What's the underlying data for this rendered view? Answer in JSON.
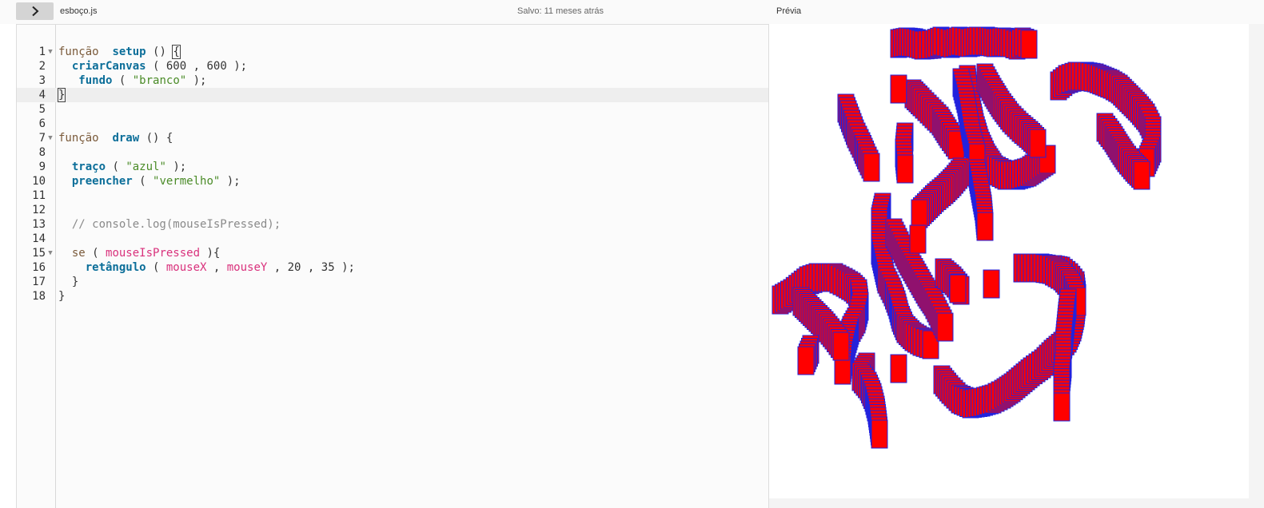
{
  "topbar": {
    "toggle_icon": "chevron-right-icon",
    "file_name": "esboço.js",
    "save_status": "Salvo: 11 meses atrás",
    "preview_label": "Prévia"
  },
  "editor": {
    "lines": [
      {
        "number": "1",
        "fold": "▼",
        "tokens": [
          [
            "kw",
            "função"
          ],
          [
            "p",
            "  "
          ],
          [
            "fn",
            "setup"
          ],
          [
            "p",
            " () "
          ],
          [
            "br",
            "{"
          ]
        ]
      },
      {
        "number": "2",
        "fold": "",
        "tokens": [
          [
            "p",
            "  "
          ],
          [
            "fn",
            "criarCanvas"
          ],
          [
            "p",
            " ( "
          ],
          [
            "num",
            "600"
          ],
          [
            "p",
            " , "
          ],
          [
            "num",
            "600"
          ],
          [
            "p",
            " );"
          ]
        ]
      },
      {
        "number": "3",
        "fold": "",
        "tokens": [
          [
            "p",
            "   "
          ],
          [
            "fn",
            "fundo"
          ],
          [
            "p",
            " ( "
          ],
          [
            "str",
            "\"branco\""
          ],
          [
            "p",
            " );"
          ]
        ]
      },
      {
        "number": "4",
        "fold": "",
        "tokens": [
          [
            "br",
            "}"
          ]
        ],
        "active": true
      },
      {
        "number": "5",
        "fold": "",
        "tokens": []
      },
      {
        "number": "6",
        "fold": "",
        "tokens": []
      },
      {
        "number": "7",
        "fold": "▼",
        "tokens": [
          [
            "kw",
            "função"
          ],
          [
            "p",
            "  "
          ],
          [
            "fn",
            "draw"
          ],
          [
            "p",
            " () {"
          ]
        ]
      },
      {
        "number": "8",
        "fold": "",
        "tokens": []
      },
      {
        "number": "9",
        "fold": "",
        "tokens": [
          [
            "p",
            "  "
          ],
          [
            "fn",
            "traço"
          ],
          [
            "p",
            " ( "
          ],
          [
            "str",
            "\"azul\""
          ],
          [
            "p",
            " );"
          ]
        ]
      },
      {
        "number": "10",
        "fold": "",
        "tokens": [
          [
            "p",
            "  "
          ],
          [
            "fn",
            "preencher"
          ],
          [
            "p",
            " ( "
          ],
          [
            "str",
            "\"vermelho\""
          ],
          [
            "p",
            " );"
          ]
        ]
      },
      {
        "number": "11",
        "fold": "",
        "tokens": []
      },
      {
        "number": "12",
        "fold": "",
        "tokens": []
      },
      {
        "number": "13",
        "fold": "",
        "tokens": [
          [
            "p",
            "  "
          ],
          [
            "cm",
            "// console.log(mouseIsPressed);"
          ]
        ]
      },
      {
        "number": "14",
        "fold": "",
        "tokens": []
      },
      {
        "number": "15",
        "fold": "▼",
        "tokens": [
          [
            "p",
            "  "
          ],
          [
            "kw",
            "se"
          ],
          [
            "p",
            " ( "
          ],
          [
            "var",
            "mouseIsPressed"
          ],
          [
            "p",
            " ){"
          ]
        ]
      },
      {
        "number": "16",
        "fold": "",
        "tokens": [
          [
            "p",
            "    "
          ],
          [
            "fn",
            "retângulo"
          ],
          [
            "p",
            " ( "
          ],
          [
            "var",
            "mouseX"
          ],
          [
            "p",
            " , "
          ],
          [
            "var",
            "mouseY"
          ],
          [
            "p",
            " , "
          ],
          [
            "num",
            "20"
          ],
          [
            "p",
            " , "
          ],
          [
            "num",
            "35"
          ],
          [
            "p",
            " );"
          ]
        ]
      },
      {
        "number": "17",
        "fold": "",
        "tokens": [
          [
            "p",
            "  }"
          ]
        ]
      },
      {
        "number": "18",
        "fold": "",
        "tokens": [
          [
            "p",
            "}"
          ]
        ]
      }
    ]
  },
  "colors": {
    "rect_fill": "#ff0000",
    "rect_stroke": "#2222dd",
    "toggle_bg": "#d4d4d4",
    "active_line": "#eeeeee"
  }
}
